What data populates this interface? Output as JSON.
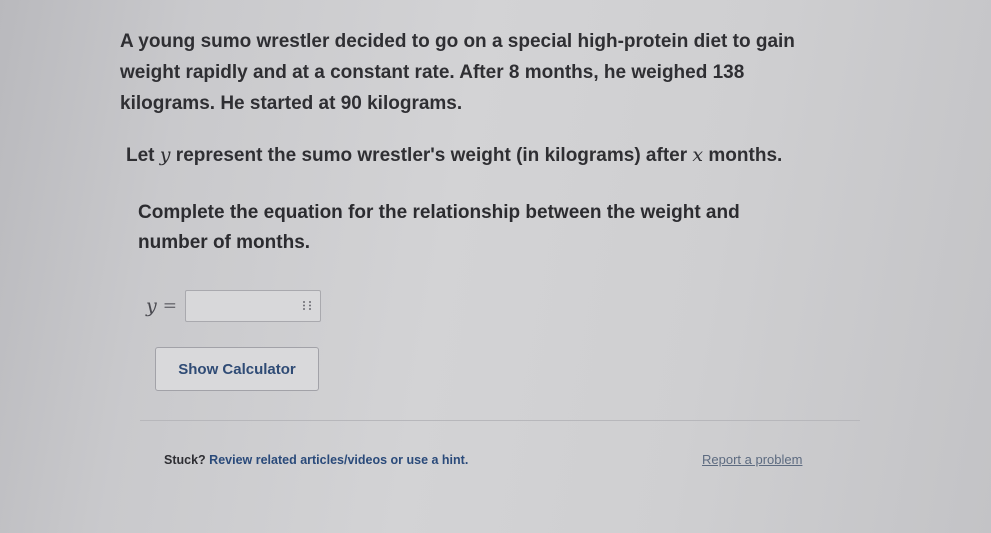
{
  "problem": {
    "line1": "A young sumo wrestler decided to go on a special high-protein diet to gain",
    "line2": "weight rapidly and at a constant rate. After 8 months, he weighed 138",
    "line3": "kilograms. He started at 90 kilograms."
  },
  "definition": {
    "prefix": "Let",
    "var_y": "y",
    "middle": "represent the sumo wrestler's weight (in kilograms) after",
    "var_x": "x",
    "suffix": "months."
  },
  "instruction": {
    "line1": "Complete the equation for the relationship between the weight and",
    "line2": "number of months."
  },
  "equation": {
    "lhs": "y",
    "sign": "=",
    "answer_value": "",
    "keypad_icon": "keypad-icon"
  },
  "calculator_button": {
    "label": "Show Calculator"
  },
  "footer": {
    "stuck_label": "Stuck?",
    "help_link": "Review related articles/videos or use a hint.",
    "report_link": "Report a problem"
  }
}
